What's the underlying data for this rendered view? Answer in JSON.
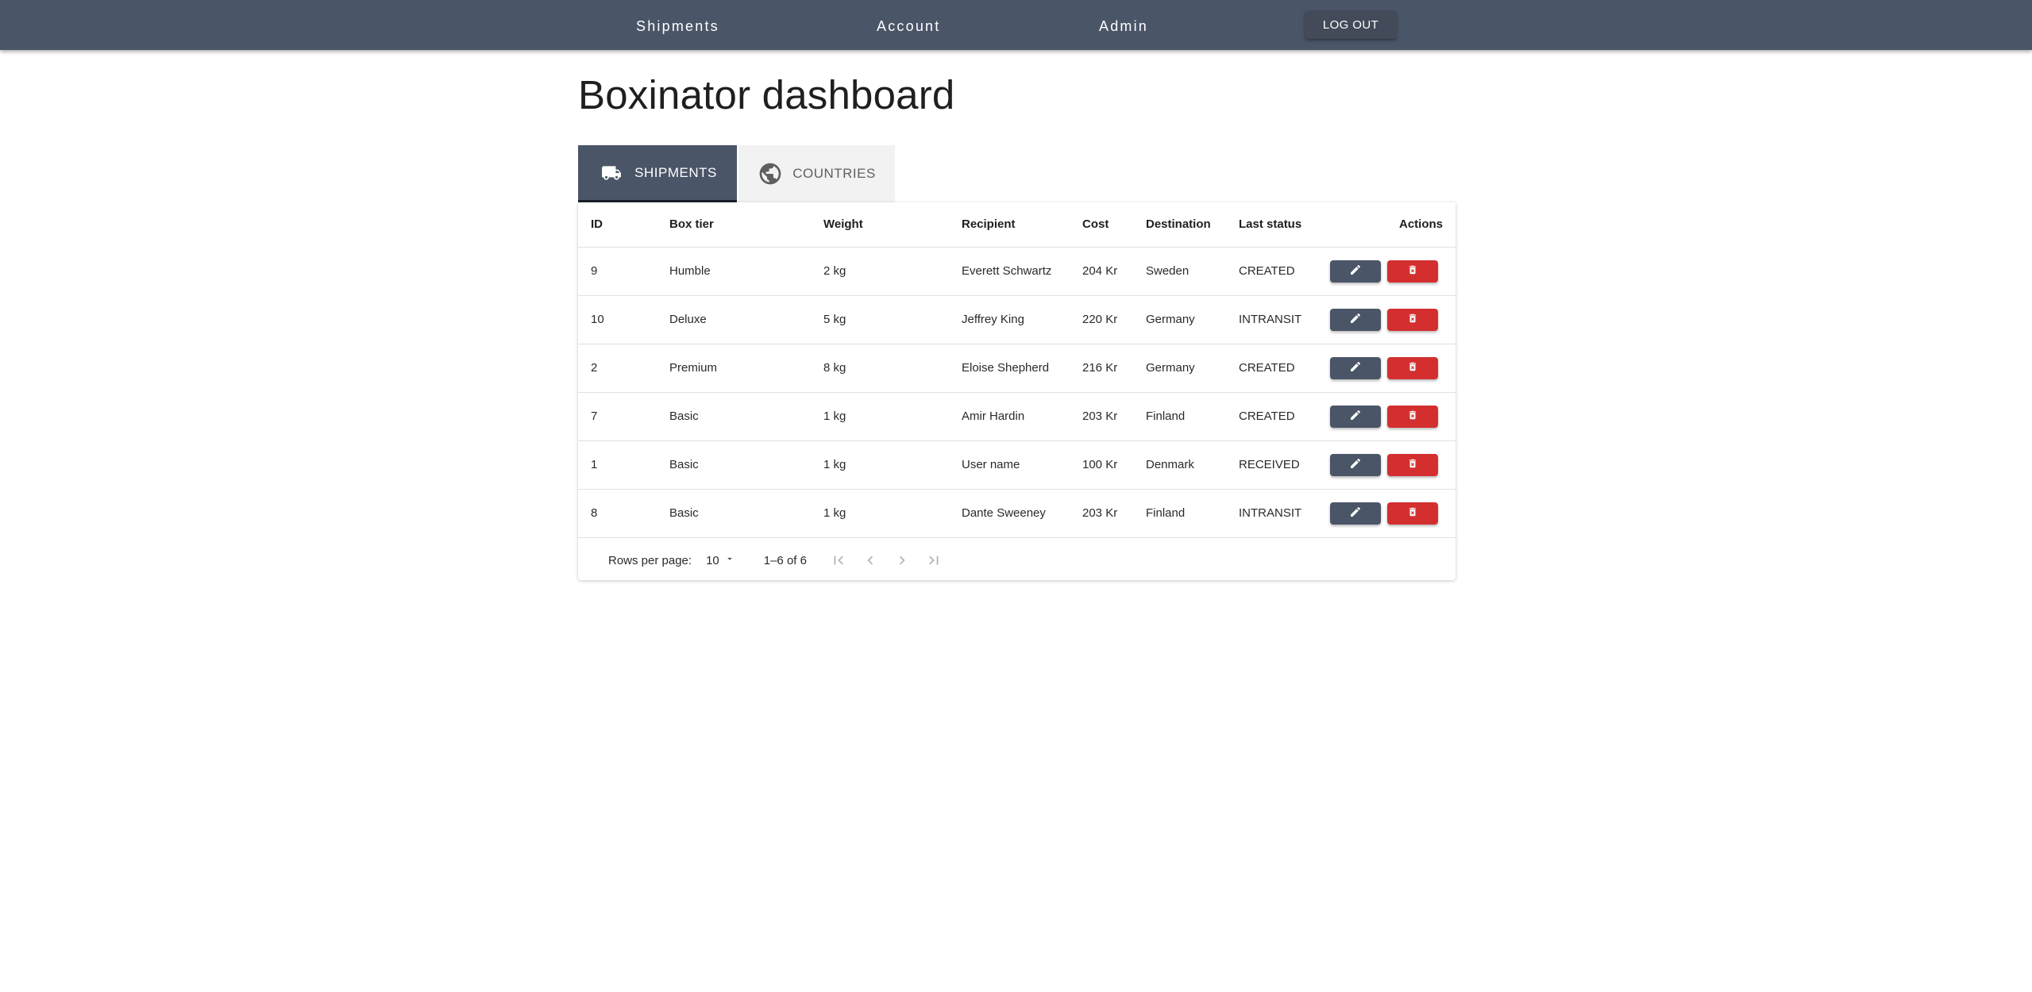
{
  "nav": {
    "links": [
      "Shipments",
      "Account",
      "Admin"
    ],
    "logout_label": "LOG OUT"
  },
  "page": {
    "title": "Boxinator dashboard"
  },
  "tabs": [
    {
      "label": "SHIPMENTS",
      "icon": "truck-icon",
      "active": true
    },
    {
      "label": "COUNTRIES",
      "icon": "globe-icon",
      "active": false
    }
  ],
  "table": {
    "columns": [
      "ID",
      "Box tier",
      "Weight",
      "Recipient",
      "Cost",
      "Destination",
      "Last status",
      "Actions"
    ],
    "rows": [
      {
        "id": "9",
        "tier": "Humble",
        "weight": "2 kg",
        "recipient": "Everett Schwartz",
        "cost": "204 Kr",
        "destination": "Sweden",
        "status": "CREATED"
      },
      {
        "id": "10",
        "tier": "Deluxe",
        "weight": "5 kg",
        "recipient": "Jeffrey King",
        "cost": "220 Kr",
        "destination": "Germany",
        "status": "INTRANSIT"
      },
      {
        "id": "2",
        "tier": "Premium",
        "weight": "8 kg",
        "recipient": "Eloise Shepherd",
        "cost": "216 Kr",
        "destination": "Germany",
        "status": "CREATED"
      },
      {
        "id": "7",
        "tier": "Basic",
        "weight": "1 kg",
        "recipient": "Amir Hardin",
        "cost": "203 Kr",
        "destination": "Finland",
        "status": "CREATED"
      },
      {
        "id": "1",
        "tier": "Basic",
        "weight": "1 kg",
        "recipient": "User name",
        "cost": "100 Kr",
        "destination": "Denmark",
        "status": "RECEIVED"
      },
      {
        "id": "8",
        "tier": "Basic",
        "weight": "1 kg",
        "recipient": "Dante Sweeney",
        "cost": "203 Kr",
        "destination": "Finland",
        "status": "INTRANSIT"
      }
    ],
    "row_actions": [
      "pencil-icon",
      "trash-icon"
    ]
  },
  "pagination": {
    "rows_per_page_label": "Rows per page:",
    "rows_per_page_value": "10",
    "range_label": "1–6 of 6"
  },
  "colors": {
    "primary": "#4a5568",
    "danger": "#d32f2f",
    "inactive_tab": "#f2f2f2"
  }
}
